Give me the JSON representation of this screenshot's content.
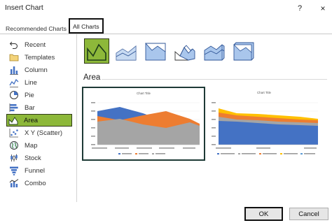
{
  "window": {
    "title": "Insert Chart",
    "help_label": "?",
    "close_label": "×"
  },
  "tabs": [
    {
      "label": "Recommended Charts",
      "selected": false
    },
    {
      "label": "All Charts",
      "selected": true
    }
  ],
  "sidebar": {
    "items": [
      {
        "label": "Recent",
        "icon": "undo-arrow-icon"
      },
      {
        "label": "Templates",
        "icon": "folder-icon"
      },
      {
        "label": "Column",
        "icon": "column-chart-icon"
      },
      {
        "label": "Line",
        "icon": "line-chart-icon"
      },
      {
        "label": "Pie",
        "icon": "pie-chart-icon"
      },
      {
        "label": "Bar",
        "icon": "bar-chart-icon"
      },
      {
        "label": "Area",
        "icon": "area-chart-icon",
        "selected": true
      },
      {
        "label": "X Y (Scatter)",
        "icon": "scatter-chart-icon"
      },
      {
        "label": "Map",
        "icon": "globe-icon"
      },
      {
        "label": "Stock",
        "icon": "stock-chart-icon"
      },
      {
        "label": "Funnel",
        "icon": "funnel-chart-icon"
      },
      {
        "label": "Combo",
        "icon": "combo-chart-icon"
      }
    ]
  },
  "main": {
    "subtypes": [
      {
        "icon": "area-subtype-icon",
        "selected": true
      },
      {
        "icon": "stacked-area-subtype-icon"
      },
      {
        "icon": "100-percent-stacked-area-subtype-icon"
      },
      {
        "icon": "3d-area-subtype-icon"
      },
      {
        "icon": "3d-stacked-area-subtype-icon"
      },
      {
        "icon": "3d-100-percent-stacked-area-subtype-icon"
      }
    ],
    "section_title": "Area",
    "previews": [
      {
        "title": "Chart Title"
      },
      {
        "title": "Chart Title"
      }
    ]
  },
  "footer": {
    "ok_label": "OK",
    "cancel_label": "Cancel"
  },
  "colors": {
    "accent_selected": "#8db83a",
    "series_blue": "#4472c4",
    "series_orange": "#ed7d31",
    "series_gray": "#a5a5a5",
    "series_yellow": "#ffc000"
  }
}
